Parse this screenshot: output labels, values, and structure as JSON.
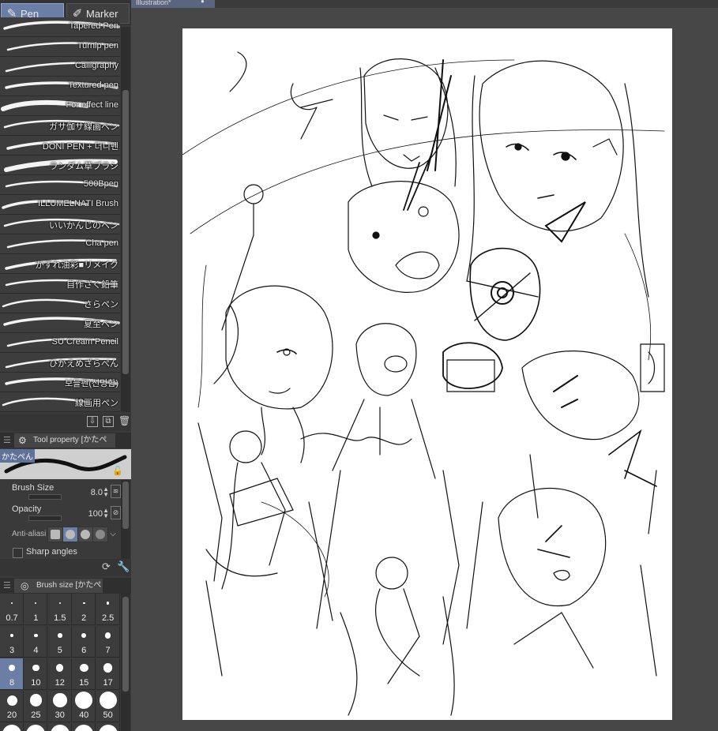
{
  "tool_tabs": [
    {
      "label": "Pen",
      "icon": "pen-icon",
      "active": true
    },
    {
      "label": "Marker",
      "icon": "marker-icon",
      "active": false
    }
  ],
  "brushes": [
    {
      "label": "Tapered Pen"
    },
    {
      "label": "Turnip pen"
    },
    {
      "label": "Calligraphy"
    },
    {
      "label": "Textured pen"
    },
    {
      "label": "For effect line"
    },
    {
      "label": "ガサ伽サ線画ペン"
    },
    {
      "label": "DONI PEN + 더니펜"
    },
    {
      "label": "ランダム草ブラシ"
    },
    {
      "label": "500Bpen"
    },
    {
      "label": "ILLUMELNATI Brush"
    },
    {
      "label": "いいかんじのペン"
    },
    {
      "label": "Cha pen"
    },
    {
      "label": "かすれ油彩■リメイク"
    },
    {
      "label": "自作ざく鉛筆"
    },
    {
      "label": "さらペン"
    },
    {
      "label": "夏至ペン"
    },
    {
      "label": "SU Cream Pencil"
    },
    {
      "label": "ひかえめざらぺん"
    },
    {
      "label": "보들펜(선명함)"
    },
    {
      "label": "線画用ペン"
    },
    {
      "label": "かたぺん",
      "selected": true
    }
  ],
  "tool_property": {
    "title": "Tool property [かたぺん]",
    "preview_label": "かたぺん",
    "brush_size_label": "Brush Size",
    "brush_size_value": "8.0",
    "opacity_label": "Opacity",
    "opacity_value": "100",
    "antialias_label": "Anti-aliasing",
    "antialias_selected": 1,
    "sharp_angles_label": "Sharp angles",
    "sharp_angles_checked": false
  },
  "brush_size_panel": {
    "title": "Brush size [かたぺん]",
    "sizes": [
      "0.7",
      "1",
      "1.5",
      "2",
      "2.5",
      "3",
      "4",
      "5",
      "6",
      "7",
      "8",
      "10",
      "12",
      "15",
      "17",
      "20",
      "25",
      "30",
      "40",
      "50"
    ],
    "selected": "8"
  },
  "document": {
    "tab_title": "Illustration*"
  },
  "colors": {
    "accent": "#6b7ea6",
    "panel_bg": "#3a3a3a",
    "canvas_bg": "#474747",
    "paper": "#ffffff"
  }
}
